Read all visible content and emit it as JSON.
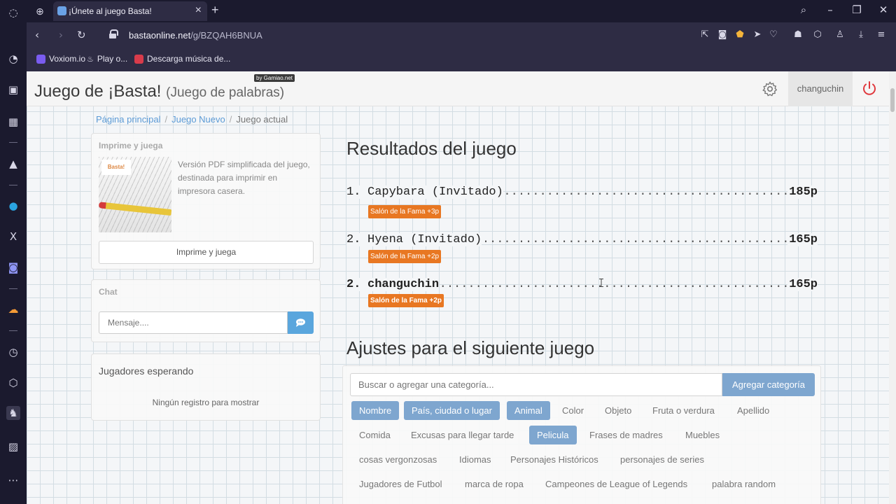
{
  "browser": {
    "tab": {
      "title": "¡Únete al juego Basta!"
    },
    "url": {
      "host": "bastaonline.net",
      "path": "/g/BZQAH6BNUA"
    },
    "bookmarks": [
      "Voxiom.io",
      "Play o...",
      "Descarga música de..."
    ]
  },
  "header": {
    "title": "Juego de ¡Basta!",
    "subtitle": "(Juego de palabras)",
    "badge": "by Gamiao.net",
    "username": "changuchin"
  },
  "breadcrumb": {
    "home": "Página principal",
    "new_game": "Juego Nuevo",
    "current": "Juego actual"
  },
  "print_panel": {
    "heading": "Imprime y juega",
    "logo": "Basta!",
    "description": "Versión PDF simplificada del juego, destinada para imprimir en impresora casera.",
    "button": "Imprime y juega"
  },
  "chat": {
    "heading": "Chat",
    "placeholder": "Mensaje...."
  },
  "waiting": {
    "heading": "Jugadores esperando",
    "empty": "Ningún registro para mostrar"
  },
  "results": {
    "title": "Resultados del juego",
    "rows": [
      {
        "rank": "1.",
        "name": "Capybara (Invitado)",
        "points": "185p",
        "badge": "Salón de la Fama +3p",
        "bold": false
      },
      {
        "rank": "2.",
        "name": "Hyena (Invitado)",
        "points": "165p",
        "badge": "Salón de la Fama +2p",
        "bold": false
      },
      {
        "rank": "2.",
        "name": "changuchin",
        "points": "165p",
        "badge": "Salón de la Fama +2p",
        "bold": true
      }
    ]
  },
  "settings": {
    "title": "Ajustes para el siguiente juego",
    "search_placeholder": "Buscar o agregar una categoría...",
    "add_button": "Agregar categoría",
    "categories": [
      {
        "label": "Nombre",
        "selected": true
      },
      {
        "label": "País, ciudad o lugar",
        "selected": true
      },
      {
        "label": "Animal",
        "selected": true
      },
      {
        "label": "Color",
        "selected": false
      },
      {
        "label": "Objeto",
        "selected": false
      },
      {
        "label": "Fruta o verdura",
        "selected": false
      },
      {
        "label": "Apellido",
        "selected": false
      },
      {
        "label": "Comida",
        "selected": false
      },
      {
        "label": "Excusas para llegar tarde",
        "selected": false
      },
      {
        "label": "Pelicula",
        "selected": true
      },
      {
        "label": "Frases de madres",
        "selected": false
      },
      {
        "label": "Muebles",
        "selected": false
      },
      {
        "label": "cosas vergonzosas",
        "selected": false
      },
      {
        "label": "Idiomas",
        "selected": false
      },
      {
        "label": "Personajes Históricos",
        "selected": false
      },
      {
        "label": "personajes de series",
        "selected": false
      },
      {
        "label": "Jugadores de Futbol",
        "selected": false
      },
      {
        "label": "marca de ropa",
        "selected": false
      },
      {
        "label": "Campeones de League of Legends",
        "selected": false
      },
      {
        "label": "palabra random",
        "selected": false
      }
    ]
  },
  "colors": {
    "accent": "#7ea6cf",
    "fame": "#e87722",
    "power": "#e0393e",
    "link": "#5c9bd6"
  }
}
